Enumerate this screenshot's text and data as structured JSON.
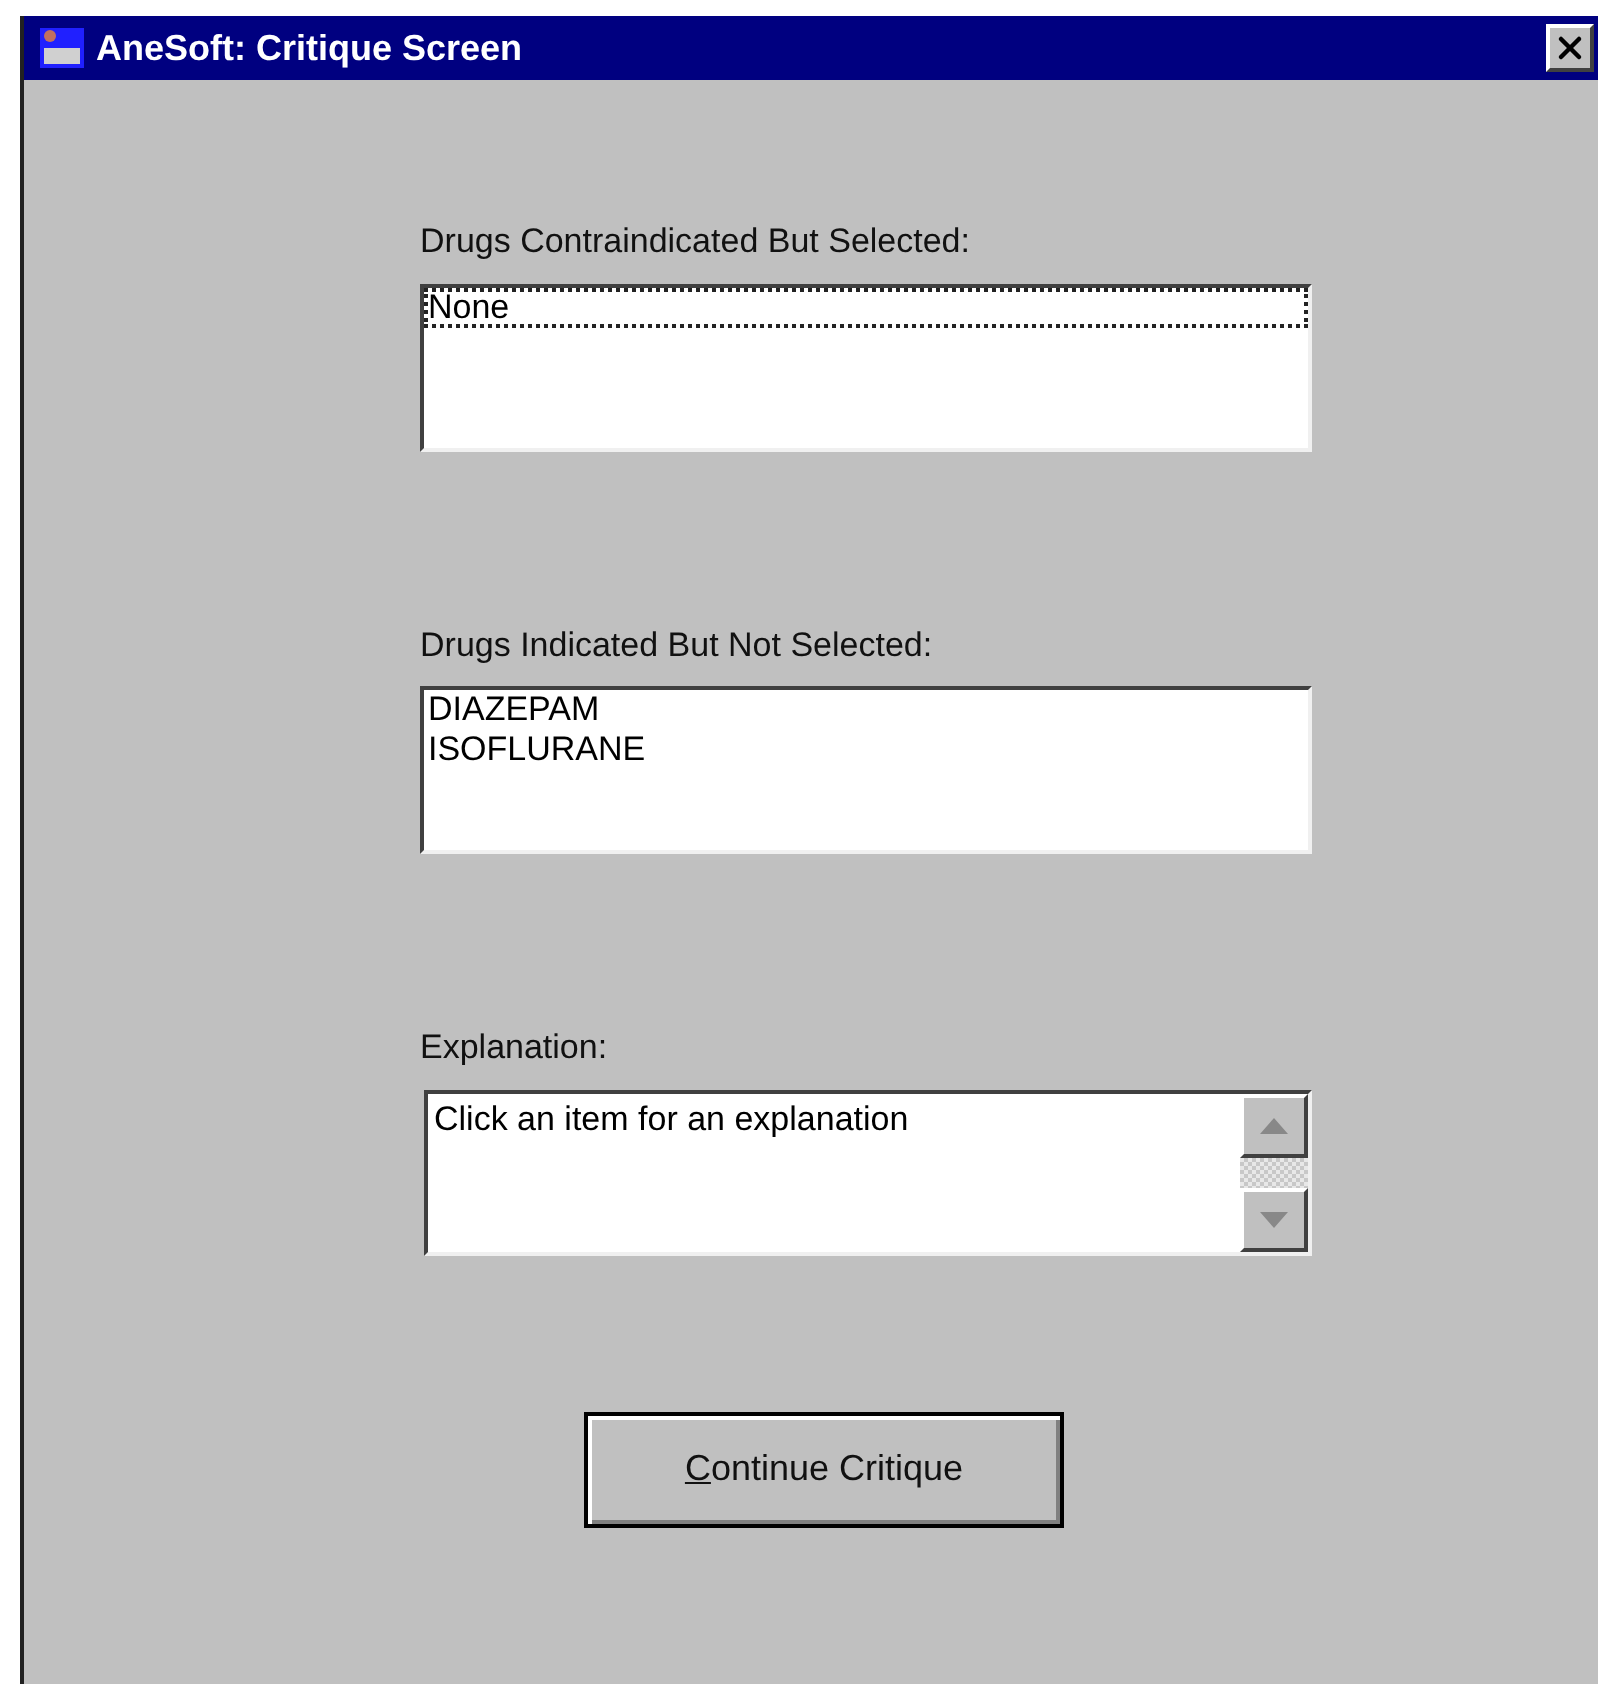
{
  "window": {
    "title": "AneSoft: Critique Screen"
  },
  "sections": [
    {
      "label": "Drugs Contraindicated But Selected:",
      "kind": "list",
      "items": [
        {
          "text": "None",
          "focused": true
        }
      ]
    },
    {
      "label": "Drugs Indicated But Not Selected:",
      "kind": "list",
      "items": [
        {
          "text": "DIAZEPAM",
          "focused": false
        },
        {
          "text": "ISOFLURANE",
          "focused": false
        }
      ]
    },
    {
      "label": "Explanation:",
      "kind": "textarea",
      "value": "Click an item for an explanation"
    }
  ],
  "button": {
    "label": "Continue Critique",
    "first_letter_underlined": true
  }
}
